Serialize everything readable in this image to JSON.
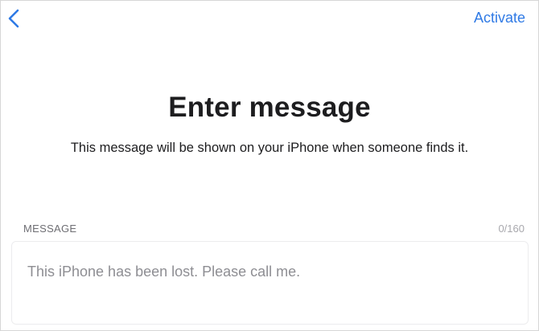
{
  "nav": {
    "back_icon": "chevron-left-icon",
    "activate_label": "Activate"
  },
  "header": {
    "title": "Enter message",
    "subtitle": "This message will be shown on your iPhone when someone finds it."
  },
  "message_field": {
    "label": "MESSAGE",
    "counter": "0/160",
    "value": "",
    "placeholder": "This iPhone has been lost. Please call me."
  },
  "colors": {
    "accent": "#2f7ae5",
    "text": "#1d1d1f",
    "placeholder": "#8e8e93"
  }
}
